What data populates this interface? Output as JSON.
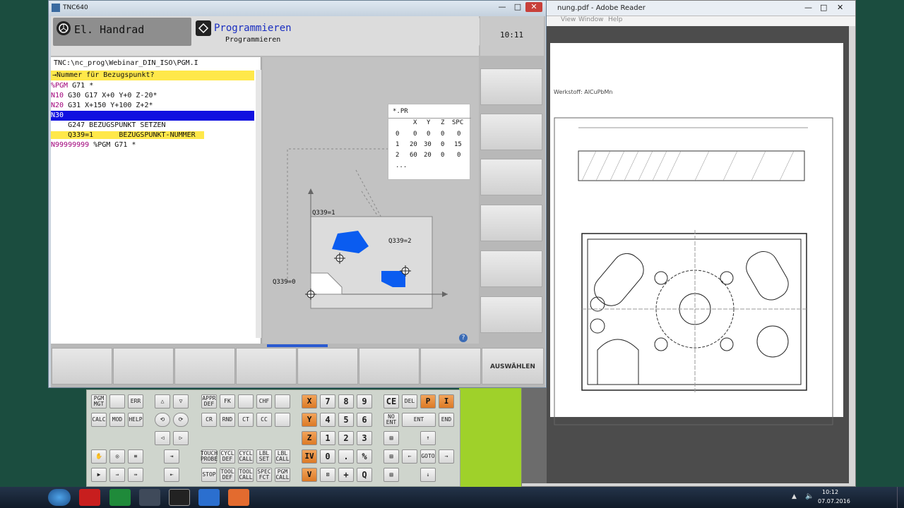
{
  "tnc_window": {
    "title": "TNC640",
    "minimize": "—",
    "maximize": "□",
    "close": "✕"
  },
  "mode_left": {
    "label": "El. Handrad",
    "icon": "handwheel-icon"
  },
  "mode_right": {
    "label": "Programmieren",
    "sublabel": "Programmieren",
    "icon": "edit-icon"
  },
  "clock": "10:11",
  "file_path": "TNC:\\nc_prog\\Webinar_DIN_ISO\\PGM.I",
  "prompt": "Nummer für Bezugspunkt?",
  "program_lines": [
    {
      "n": "%PGM",
      "rest": " G71 *"
    },
    {
      "n": "N10",
      "rest": " G30 G17 X+0 Y+0 Z-20*"
    },
    {
      "n": "N20",
      "rest": " G31 X+150 Y+100 Z+2*"
    },
    {
      "n": "N30",
      "rest": ""
    },
    {
      "n": "",
      "rest": "    G247 BEZUGSPUNKT SETZEN"
    },
    {
      "n": "",
      "rest": "    Q339=1      BEZUGSPUNKT-NUMMER"
    },
    {
      "n": "N99999999",
      "rest": " %PGM G71 *"
    }
  ],
  "table": {
    "title": "*.PR",
    "headers": [
      "",
      "X",
      "Y",
      "Z",
      "SPC"
    ],
    "rows": [
      [
        "0",
        "0",
        "0",
        "0",
        "0"
      ],
      [
        "1",
        "20",
        "30",
        "0",
        "15"
      ],
      [
        "2",
        "60",
        "20",
        "0",
        "0"
      ]
    ],
    "more": "..."
  },
  "figure_labels": {
    "q1": "Q339=1",
    "q2": "Q339=2",
    "q0": "Q339=0"
  },
  "softkeys": [
    "",
    "",
    "",
    "",
    "",
    "",
    "",
    "AUSWÄHLEN"
  ],
  "adobe": {
    "title": "nung.pdf - Adobe Reader",
    "menu": [
      "View",
      "Window",
      "Help"
    ],
    "material": "Werkstoff: AlCuPbMn"
  },
  "keyboard": {
    "row1": [
      "PGM MGT",
      "",
      "ERR",
      "△",
      "▽",
      "APPR DEF",
      "FK",
      "",
      "CHF",
      "",
      "X",
      "7",
      "8",
      "9",
      "CE",
      "DEL",
      "P",
      "I"
    ],
    "row2": [
      "CALC",
      "MOD",
      "HELP",
      "",
      "",
      "CR",
      "RND",
      "CT",
      "CC",
      "",
      "Y",
      "4",
      "5",
      "6",
      "NO ENT",
      "ENT",
      "END"
    ],
    "row3": [
      "◁",
      "▷",
      "",
      "",
      "",
      "",
      "",
      "",
      "",
      "Z",
      "1",
      "2",
      "3",
      "",
      "↑"
    ],
    "row4": [
      "",
      "",
      "",
      "TOUCH PROBE",
      "CYCL DEF",
      "CYCL CALL",
      "LBL SET",
      "LBL CALL",
      "IV",
      "0",
      ".",
      "%",
      "",
      "←",
      "GOTO",
      "→"
    ],
    "row5": [
      "",
      "",
      "",
      "STOP",
      "TOOL DEF",
      "TOOL CALL",
      "SPEC FCT",
      "PGM CALL",
      "V",
      "",
      "+",
      "Q",
      "",
      "↓"
    ]
  },
  "taskbar": {
    "time": "10:12",
    "date": "07.07.2016"
  },
  "colors": {
    "prompt_bg": "#ffe84a",
    "cursor_bg": "#1010e0",
    "blue_shape": "#0a5cf0",
    "keyword": "#a0007a"
  }
}
